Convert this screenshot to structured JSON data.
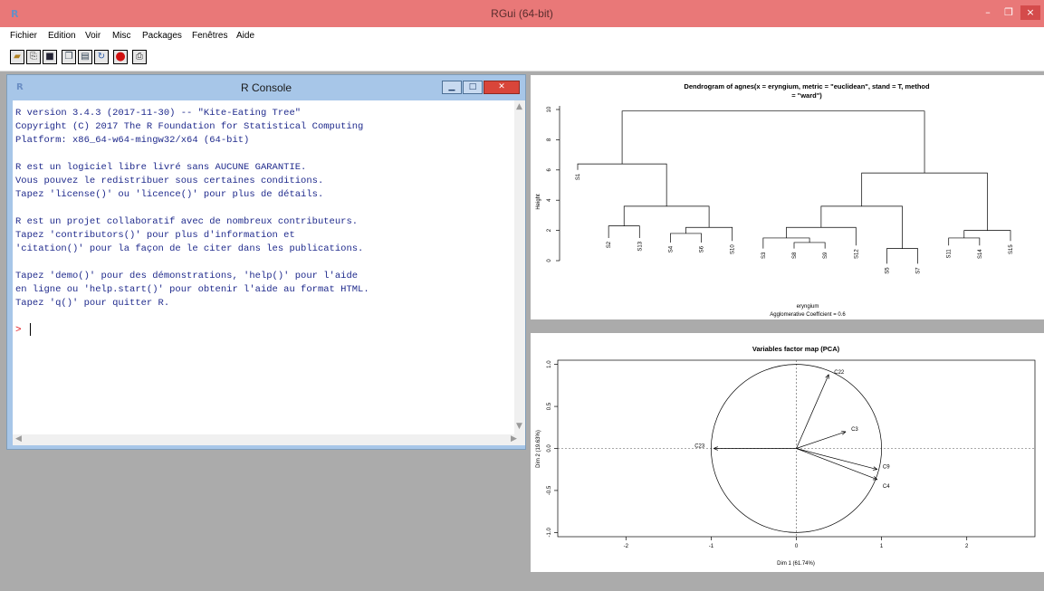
{
  "window": {
    "title": "RGui (64-bit)",
    "icon": "R",
    "minimize": "–",
    "restore": "❐",
    "close": "×"
  },
  "menu": [
    "Fichier",
    "Edition",
    "Voir",
    "Misc",
    "Packages",
    "Fenêtres",
    "Aide"
  ],
  "toolbar_icons": [
    "open-script-icon",
    "load-workspace-icon",
    "save-workspace-icon",
    "copy-icon",
    "paste-icon",
    "copy-paste-icon",
    "stop-icon",
    "print-icon"
  ],
  "console": {
    "title": "R Console",
    "icon": "R",
    "text": "R version 3.4.3 (2017-11-30) -- \"Kite-Eating Tree\"\nCopyright (C) 2017 The R Foundation for Statistical Computing\nPlatform: x86_64-w64-mingw32/x64 (64-bit)\n\nR est un logiciel libre livré sans AUCUNE GARANTIE.\nVous pouvez le redistribuer sous certaines conditions.\nTapez 'license()' ou 'licence()' pour plus de détails.\n\nR est un projet collaboratif avec de nombreux contributeurs.\nTapez 'contributors()' pour plus d'information et\n'citation()' pour la façon de le citer dans les publications.\n\nTapez 'demo()' pour des démonstrations, 'help()' pour l'aide\nen ligne ou 'help.start()' pour obtenir l'aide au format HTML.\nTapez 'q()' pour quitter R.",
    "prompt": ">"
  },
  "chart_data": [
    {
      "type": "dendrogram",
      "title": "Dendrogram of  agnes(x = eryngium, metric = \"euclidean\", stand = T, method\n= \"ward\")",
      "xlabel": "eryngium",
      "subtitle": "Agglomerative Coefficient =  0.6",
      "ylabel": "Height",
      "ylim": [
        0,
        10
      ],
      "yticks": [
        0,
        2,
        4,
        6,
        8,
        10
      ],
      "leaves": [
        {
          "label": "S1",
          "h": 6.0
        },
        {
          "label": "S2",
          "h": 1.5
        },
        {
          "label": "S13",
          "h": 1.5
        },
        {
          "label": "S4",
          "h": 1.2
        },
        {
          "label": "S6",
          "h": 1.2
        },
        {
          "label": "S10",
          "h": 1.3
        },
        {
          "label": "S3",
          "h": 0.8
        },
        {
          "label": "S8",
          "h": 0.8
        },
        {
          "label": "S9",
          "h": 0.8
        },
        {
          "label": "S12",
          "h": 1.0
        },
        {
          "label": "S5",
          "h": -0.2
        },
        {
          "label": "S7",
          "h": -0.2
        },
        {
          "label": "S11",
          "h": 1.0
        },
        {
          "label": "S14",
          "h": 1.0
        },
        {
          "label": "S15",
          "h": 1.3
        }
      ],
      "merges": [
        {
          "left": {
            "leaf": 1
          },
          "right": {
            "leaf": 2
          },
          "h": 2.3
        },
        {
          "left": {
            "leaf": 3
          },
          "right": {
            "leaf": 4
          },
          "h": 1.8
        },
        {
          "left": {
            "merge": 1
          },
          "right": {
            "leaf": 5
          },
          "h": 2.2
        },
        {
          "left": {
            "merge": 0
          },
          "right": {
            "merge": 2
          },
          "h": 3.6
        },
        {
          "left": {
            "leaf": 0
          },
          "right": {
            "merge": 3
          },
          "h": 6.4
        },
        {
          "left": {
            "leaf": 7
          },
          "right": {
            "leaf": 8
          },
          "h": 1.2
        },
        {
          "left": {
            "leaf": 6
          },
          "right": {
            "merge": 5
          },
          "h": 1.5
        },
        {
          "left": {
            "merge": 6
          },
          "right": {
            "leaf": 9
          },
          "h": 2.2
        },
        {
          "left": {
            "leaf": 10
          },
          "right": {
            "leaf": 11
          },
          "h": 0.8
        },
        {
          "left": {
            "merge": 7
          },
          "right": {
            "merge": 8
          },
          "h": 3.6
        },
        {
          "left": {
            "leaf": 12
          },
          "right": {
            "leaf": 13
          },
          "h": 1.5
        },
        {
          "left": {
            "merge": 10
          },
          "right": {
            "leaf": 14
          },
          "h": 2.0
        },
        {
          "left": {
            "merge": 9
          },
          "right": {
            "merge": 11
          },
          "h": 5.8
        },
        {
          "left": {
            "merge": 4
          },
          "right": {
            "merge": 12
          },
          "h": 9.9
        }
      ]
    },
    {
      "type": "pca-variables",
      "title": "Variables factor map (PCA)",
      "xlabel": "Dim 1 (61.74%)",
      "ylabel": "Dim 2 (19.63%)",
      "xlim": [
        -2.8,
        2.8
      ],
      "ylim": [
        -1.05,
        1.05
      ],
      "xticks": [
        -2,
        -1,
        0,
        1,
        2
      ],
      "yticks": [
        -1.0,
        -0.5,
        0.0,
        0.5,
        1.0
      ],
      "circle_radius": 1,
      "arrows": [
        {
          "label": "C22",
          "x": 0.38,
          "y": 0.88
        },
        {
          "label": "C3",
          "x": 0.58,
          "y": 0.2
        },
        {
          "label": "C9",
          "x": 0.95,
          "y": -0.25
        },
        {
          "label": "C4",
          "x": 0.95,
          "y": -0.37
        },
        {
          "label": "C23",
          "x": -0.97,
          "y": 0.0
        }
      ]
    }
  ]
}
